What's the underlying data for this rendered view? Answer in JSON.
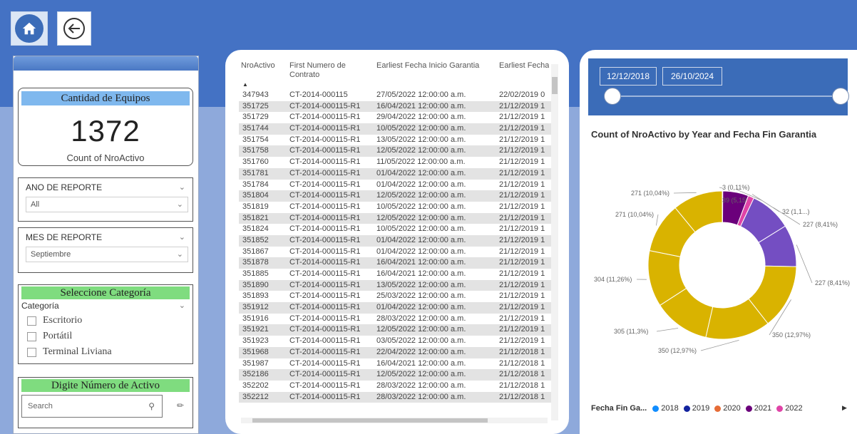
{
  "colors": {
    "topbar": "#4472C4",
    "kpi_title_bg": "#7fb8ee",
    "slicer_title_bg": "#7fdc7f",
    "date_box_bg": "#3b6cb8"
  },
  "nav": {
    "home_icon": "home-icon",
    "back_icon": "back-arrow-icon"
  },
  "kpi": {
    "title": "Cantidad de Equipos",
    "value": "1372",
    "subtitle": "Count of NroActivo"
  },
  "slicers": {
    "ano": {
      "label": "ANO DE REPORTE",
      "value": "All"
    },
    "mes": {
      "label": "MES DE REPORTE",
      "value": "Septiembre"
    }
  },
  "categoria": {
    "title": "Seleccione Categoría",
    "label": "Categoría",
    "items": [
      "Escritorio",
      "Portátil",
      "Terminal Liviana"
    ]
  },
  "search": {
    "title": "Digite Número de Activo",
    "placeholder": "Search"
  },
  "table": {
    "headers": [
      "NroActivo",
      "First Numero de Contrato",
      "Earliest Fecha Inicio Garantia",
      "Earliest Fecha"
    ],
    "rows": [
      [
        "347943",
        "CT-2014-000115",
        "27/05/2022 12:00:00 a.m.",
        "22/02/2019 0"
      ],
      [
        "351725",
        "CT-2014-000115-R1",
        "16/04/2021 12:00:00 a.m.",
        "21/12/2019 1"
      ],
      [
        "351729",
        "CT-2014-000115-R1",
        "29/04/2022 12:00:00 a.m.",
        "21/12/2019 1"
      ],
      [
        "351744",
        "CT-2014-000115-R1",
        "10/05/2022 12:00:00 a.m.",
        "21/12/2019 1"
      ],
      [
        "351754",
        "CT-2014-000115-R1",
        "13/05/2022 12:00:00 a.m.",
        "21/12/2019 1"
      ],
      [
        "351758",
        "CT-2014-000115-R1",
        "12/05/2022 12:00:00 a.m.",
        "21/12/2019 1"
      ],
      [
        "351760",
        "CT-2014-000115-R1",
        "11/05/2022 12:00:00 a.m.",
        "21/12/2019 1"
      ],
      [
        "351781",
        "CT-2014-000115-R1",
        "01/04/2022 12:00:00 a.m.",
        "21/12/2019 1"
      ],
      [
        "351784",
        "CT-2014-000115-R1",
        "01/04/2022 12:00:00 a.m.",
        "21/12/2019 1"
      ],
      [
        "351804",
        "CT-2014-000115-R1",
        "12/05/2022 12:00:00 a.m.",
        "21/12/2019 1"
      ],
      [
        "351819",
        "CT-2014-000115-R1",
        "10/05/2022 12:00:00 a.m.",
        "21/12/2019 1"
      ],
      [
        "351821",
        "CT-2014-000115-R1",
        "12/05/2022 12:00:00 a.m.",
        "21/12/2019 1"
      ],
      [
        "351824",
        "CT-2014-000115-R1",
        "10/05/2022 12:00:00 a.m.",
        "21/12/2019 1"
      ],
      [
        "351852",
        "CT-2014-000115-R1",
        "01/04/2022 12:00:00 a.m.",
        "21/12/2019 1"
      ],
      [
        "351867",
        "CT-2014-000115-R1",
        "01/04/2022 12:00:00 a.m.",
        "21/12/2019 1"
      ],
      [
        "351878",
        "CT-2014-000115-R1",
        "16/04/2021 12:00:00 a.m.",
        "21/12/2019 1"
      ],
      [
        "351885",
        "CT-2014-000115-R1",
        "16/04/2021 12:00:00 a.m.",
        "21/12/2019 1"
      ],
      [
        "351890",
        "CT-2014-000115-R1",
        "13/05/2022 12:00:00 a.m.",
        "21/12/2019 1"
      ],
      [
        "351893",
        "CT-2014-000115-R1",
        "25/03/2022 12:00:00 a.m.",
        "21/12/2019 1"
      ],
      [
        "351912",
        "CT-2014-000115-R1",
        "01/04/2022 12:00:00 a.m.",
        "21/12/2019 1"
      ],
      [
        "351916",
        "CT-2014-000115-R1",
        "28/03/2022 12:00:00 a.m.",
        "21/12/2019 1"
      ],
      [
        "351921",
        "CT-2014-000115-R1",
        "12/05/2022 12:00:00 a.m.",
        "21/12/2019 1"
      ],
      [
        "351923",
        "CT-2014-000115-R1",
        "03/05/2022 12:00:00 a.m.",
        "21/12/2019 1"
      ],
      [
        "351968",
        "CT-2014-000115-R1",
        "22/04/2022 12:00:00 a.m.",
        "21/12/2018 1"
      ],
      [
        "351987",
        "CT-2014-000115-R1",
        "16/04/2021 12:00:00 a.m.",
        "21/12/2018 1"
      ],
      [
        "352186",
        "CT-2014-000115-R1",
        "12/05/2022 12:00:00 a.m.",
        "21/12/2018 1"
      ],
      [
        "352202",
        "CT-2014-000115-R1",
        "28/03/2022 12:00:00 a.m.",
        "21/12/2018 1"
      ],
      [
        "352212",
        "CT-2014-000115-R1",
        "28/03/2022 12:00:00 a.m.",
        "21/12/2018 1"
      ]
    ]
  },
  "date_range": {
    "start": "12/12/2018",
    "end": "26/10/2024"
  },
  "chart_data": {
    "type": "pie",
    "title": "Count of NroActivo by Year and Fecha Fin Garantia",
    "legend_title": "Fecha Fin Ga...",
    "legend": [
      {
        "name": "2018",
        "color": "#118DFF"
      },
      {
        "name": "2019",
        "color": "#12239E"
      },
      {
        "name": "2020",
        "color": "#E66C37"
      },
      {
        "name": "2021",
        "color": "#6B007B"
      },
      {
        "name": "2022",
        "color": "#E044A7"
      }
    ],
    "slices": [
      {
        "value": 3,
        "label": "3 (0,11%)",
        "color": "#12239E"
      },
      {
        "value": 139,
        "label": "139 (5,15%)",
        "color": "#6B007B"
      },
      {
        "value": 32,
        "label": "32 (1,1...)",
        "color": "#E044A7"
      },
      {
        "value": 227,
        "label": "227 (8,41%)",
        "color": "#744EC2"
      },
      {
        "value": 227,
        "label": "227 (8,41%)",
        "color": "#744EC2"
      },
      {
        "value": 350,
        "label": "350 (12,97%)",
        "color": "#D9B300"
      },
      {
        "value": 350,
        "label": "350 (12,97%)",
        "color": "#D9B300"
      },
      {
        "value": 305,
        "label": "305 (11,3%)",
        "color": "#D9B300"
      },
      {
        "value": 304,
        "label": "304 (11,26%)",
        "color": "#D9B300"
      },
      {
        "value": 271,
        "label": "271 (10,04%)",
        "color": "#D9B300"
      },
      {
        "value": 271,
        "label": "271 (10,04%)",
        "color": "#D9B300"
      }
    ]
  }
}
